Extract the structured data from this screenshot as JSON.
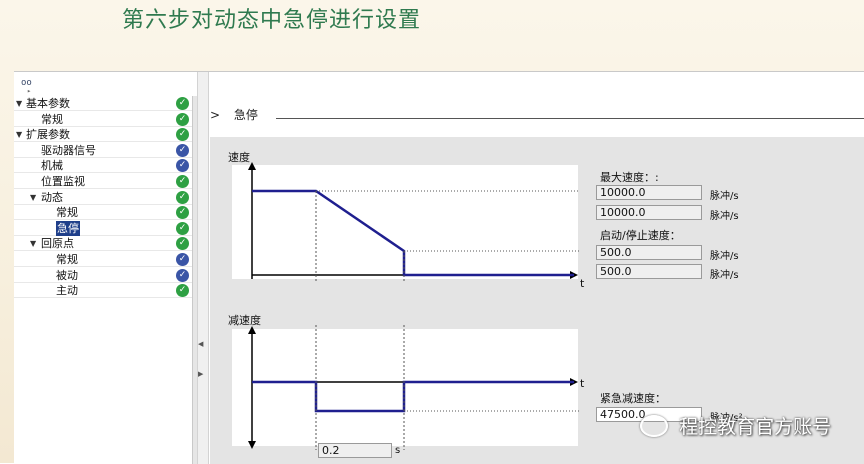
{
  "slide": {
    "title": "第六步对动态中急停进行设置"
  },
  "tree": {
    "items": [
      {
        "label": "基本参数",
        "arrow": "▼",
        "status": "ok"
      },
      {
        "label": "常规",
        "arrow": "",
        "status": "ok"
      },
      {
        "label": "扩展参数",
        "arrow": "▼",
        "status": "ok"
      },
      {
        "label": "驱动器信号",
        "arrow": "",
        "status": "info"
      },
      {
        "label": "机械",
        "arrow": "",
        "status": "info"
      },
      {
        "label": "位置监视",
        "arrow": "",
        "status": "ok"
      },
      {
        "label": "动态",
        "arrow": "▼",
        "status": "ok"
      },
      {
        "label": "常规",
        "arrow": "",
        "status": "ok"
      },
      {
        "label": "急停",
        "arrow": "",
        "status": "ok",
        "selected": true
      },
      {
        "label": "回原点",
        "arrow": "▼",
        "status": "ok"
      },
      {
        "label": "常规",
        "arrow": "",
        "status": "info"
      },
      {
        "label": "被动",
        "arrow": "",
        "status": "info"
      },
      {
        "label": "主动",
        "arrow": "",
        "status": "ok"
      }
    ]
  },
  "section": {
    "arrow": ">",
    "title": "急停"
  },
  "chart_velocity": {
    "ylabel": "速度",
    "xlabel": "t"
  },
  "chart_decel": {
    "ylabel": "减速度",
    "xlabel": "t"
  },
  "params": {
    "max_speed_label": "最大速度：:",
    "max_speed_1": "10000.0",
    "max_speed_2": "10000.0",
    "start_stop_label": "启动/停止速度：",
    "start_stop_1": "500.0",
    "start_stop_2": "500.0",
    "emergency_decel_label": "紧急减速度：",
    "emergency_decel": "47500.0",
    "unit_speed": "脉冲/s",
    "unit_accel": "脉冲/s²",
    "time_value": "0.2",
    "time_unit": "s"
  },
  "watermark": {
    "text": "程控教育官方账号"
  },
  "colors": {
    "title": "#2f7a4f",
    "curve": "#1f1f8f",
    "selection": "#1f3f8a"
  }
}
